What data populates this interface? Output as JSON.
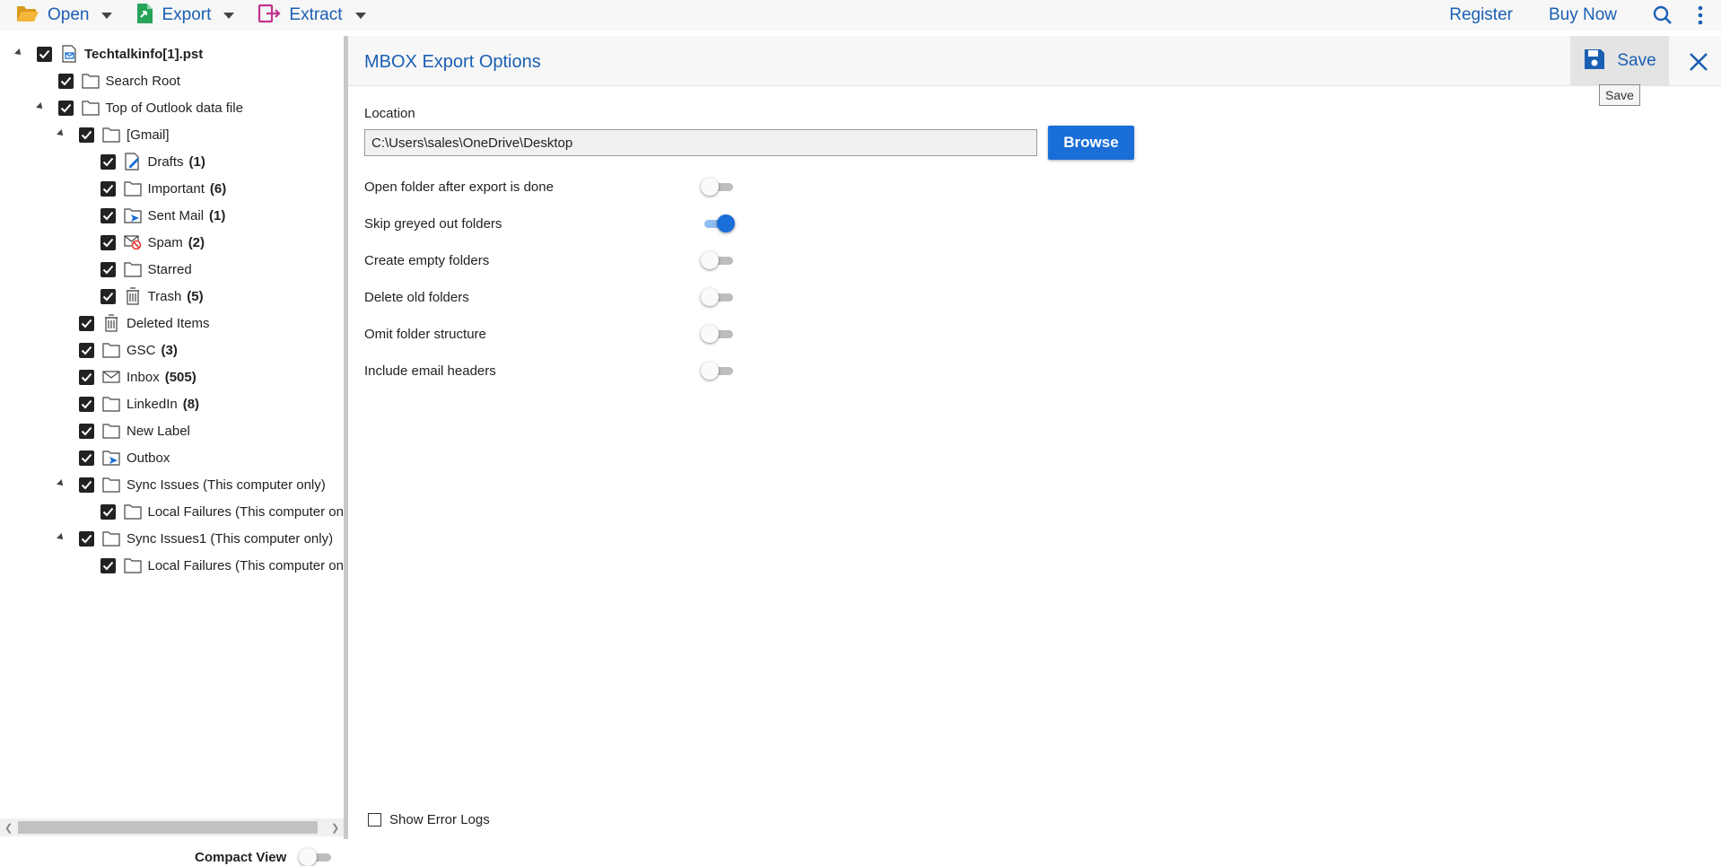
{
  "toolbar": {
    "open_label": "Open",
    "export_label": "Export",
    "extract_label": "Extract",
    "register_label": "Register",
    "buy_now_label": "Buy Now",
    "icons": {
      "open": "folder-open-icon",
      "export": "export-file-icon",
      "extract": "extract-icon",
      "search": "search-icon",
      "more": "more-vertical-icon"
    }
  },
  "tree": {
    "items": [
      {
        "label": "Techtalkinfo[1].pst",
        "count": "",
        "icon": "pst-file-icon"
      },
      {
        "label": "Search Root",
        "count": "",
        "icon": "folder-icon"
      },
      {
        "label": "Top of Outlook data file",
        "count": "",
        "icon": "folder-icon"
      },
      {
        "label": "[Gmail]",
        "count": "",
        "icon": "folder-icon"
      },
      {
        "label": "Drafts",
        "count": "(1)",
        "icon": "drafts-icon"
      },
      {
        "label": "Important",
        "count": "(6)",
        "icon": "folder-icon"
      },
      {
        "label": "Sent Mail",
        "count": "(1)",
        "icon": "sent-mail-icon"
      },
      {
        "label": "Spam",
        "count": "(2)",
        "icon": "spam-icon"
      },
      {
        "label": "Starred",
        "count": "",
        "icon": "folder-icon"
      },
      {
        "label": "Trash",
        "count": "(5)",
        "icon": "trash-icon"
      },
      {
        "label": "Deleted Items",
        "count": "",
        "icon": "trash-icon"
      },
      {
        "label": "GSC",
        "count": "(3)",
        "icon": "folder-icon"
      },
      {
        "label": "Inbox",
        "count": "(505)",
        "icon": "inbox-icon"
      },
      {
        "label": "LinkedIn",
        "count": "(8)",
        "icon": "folder-icon"
      },
      {
        "label": "New Label",
        "count": "",
        "icon": "folder-icon"
      },
      {
        "label": "Outbox",
        "count": "",
        "icon": "outbox-icon"
      },
      {
        "label": "Sync Issues (This computer only)",
        "count": "",
        "icon": "folder-icon"
      },
      {
        "label": "Local Failures (This computer only)",
        "count": "",
        "icon": "folder-icon"
      },
      {
        "label": "Sync Issues1 (This computer only)",
        "count": "",
        "icon": "folder-icon"
      },
      {
        "label": "Local Failures (This computer only)",
        "count": "",
        "icon": "folder-icon"
      }
    ]
  },
  "compact_view_label": "Compact View",
  "panel": {
    "title": "MBOX Export Options",
    "save_label": "Save",
    "save_tooltip": "Save",
    "location_label": "Location",
    "location_value": "C:\\Users\\sales\\OneDrive\\Desktop",
    "browse_label": "Browse",
    "options": [
      {
        "label": "Open folder after export is done",
        "on": false
      },
      {
        "label": "Skip greyed out folders",
        "on": true
      },
      {
        "label": "Create empty folders",
        "on": false
      },
      {
        "label": "Delete old folders",
        "on": false
      },
      {
        "label": "Omit folder structure",
        "on": false
      },
      {
        "label": "Include email headers",
        "on": false
      }
    ],
    "show_error_logs_label": "Show Error Logs"
  },
  "colors": {
    "accent": "#1a5fb4",
    "button": "#1a6ed8",
    "toggle_on": "#1a6ed8"
  }
}
